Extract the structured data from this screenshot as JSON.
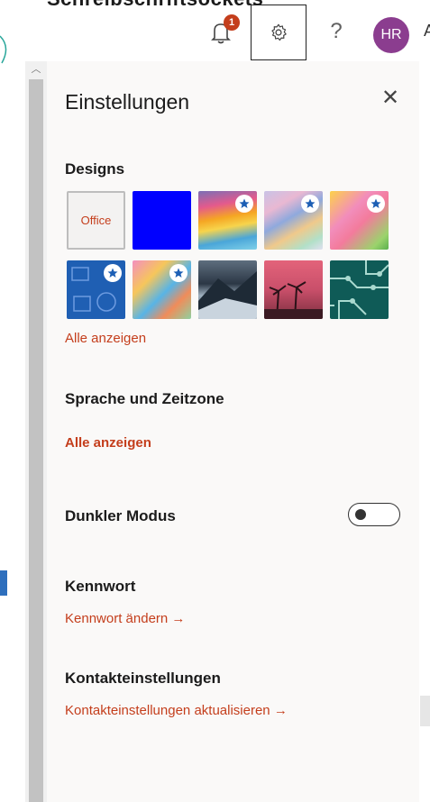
{
  "header": {
    "cut_title": "Schreibschriftsockets",
    "notification_count": "1",
    "help_label": "?",
    "avatar_initials": "HR",
    "avatar_color": "#8b3d8f",
    "edge_text": "A"
  },
  "settings_panel": {
    "title": "Einstellungen",
    "close_label": "✕",
    "accent_color": "#c43e1c",
    "designs": {
      "heading": "Designs",
      "office_tile_label": "Office",
      "themes": [
        {
          "name": "office",
          "starred": false
        },
        {
          "name": "blue",
          "starred": false
        },
        {
          "name": "colorful-waves",
          "starred": true
        },
        {
          "name": "pastel-swirl",
          "starred": true
        },
        {
          "name": "pink-unicorn",
          "starred": true
        },
        {
          "name": "blue-circuit-doodle",
          "starred": true
        },
        {
          "name": "colorful-pixels",
          "starred": true
        },
        {
          "name": "mountain",
          "starred": false
        },
        {
          "name": "palm-sunset",
          "starred": false
        },
        {
          "name": "teal-circuit",
          "starred": false
        }
      ],
      "show_all": "Alle anzeigen"
    },
    "language": {
      "heading": "Sprache und Zeitzone",
      "show_all": "Alle anzeigen"
    },
    "dark_mode": {
      "label": "Dunkler Modus",
      "enabled": false
    },
    "password": {
      "heading": "Kennwort",
      "link": "Kennwort ändern →"
    },
    "contacts": {
      "heading": "Kontakteinstellungen",
      "link": "Kontakteinstellungen aktualisieren →"
    }
  }
}
